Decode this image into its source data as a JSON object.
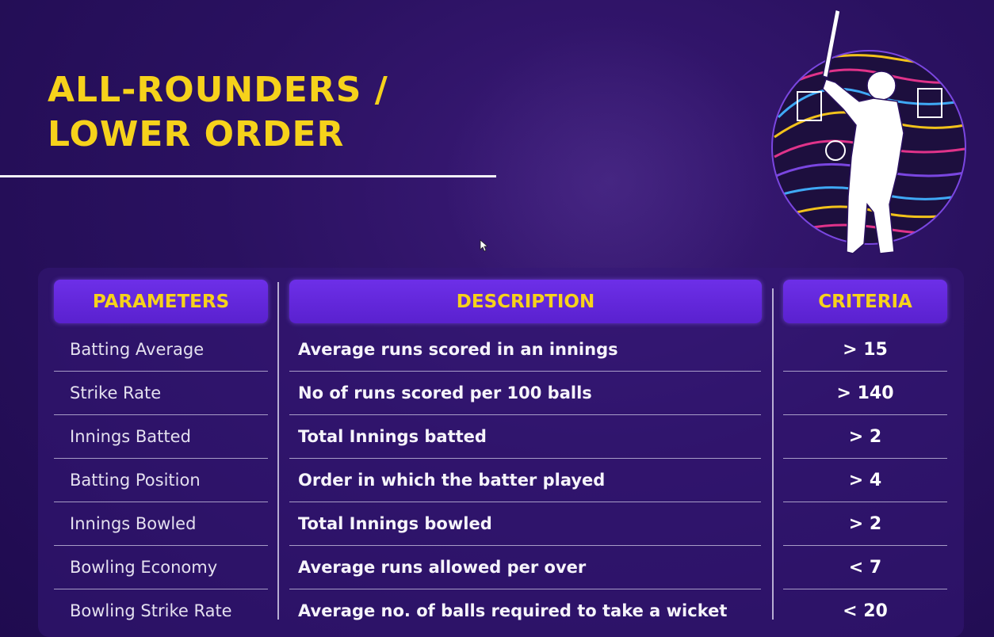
{
  "slide": {
    "title_line1": "ALL-ROUNDERS /",
    "title_line2": "LOWER ORDER"
  },
  "table": {
    "headers": {
      "parameters": "PARAMETERS",
      "description": "DESCRIPTION",
      "criteria": "CRITERIA"
    },
    "rows": [
      {
        "parameter": "Batting Average",
        "description": "Average runs scored in an innings",
        "criteria": "> 15"
      },
      {
        "parameter": "Strike Rate",
        "description": "No of runs scored per 100 balls",
        "criteria": "> 140"
      },
      {
        "parameter": "Innings Batted",
        "description": "Total Innings batted",
        "criteria": "> 2"
      },
      {
        "parameter": "Batting Position",
        "description": "Order in which the batter played",
        "criteria": "> 4"
      },
      {
        "parameter": "Innings Bowled",
        "description": "Total Innings bowled",
        "criteria": "> 2"
      },
      {
        "parameter": "Bowling Economy",
        "description": "Average runs allowed per over",
        "criteria": "< 7"
      },
      {
        "parameter": "Bowling Strike Rate",
        "description": "Average no. of balls required to take a wicket",
        "criteria": "< 20"
      }
    ]
  },
  "colors": {
    "accent_yellow": "#f6d21b",
    "header_purple": "#6d2fe8",
    "background": "#2a1160"
  },
  "icons": {
    "logo": "cricket-batsman-logo-icon",
    "cursor": "mouse-pointer-icon"
  }
}
